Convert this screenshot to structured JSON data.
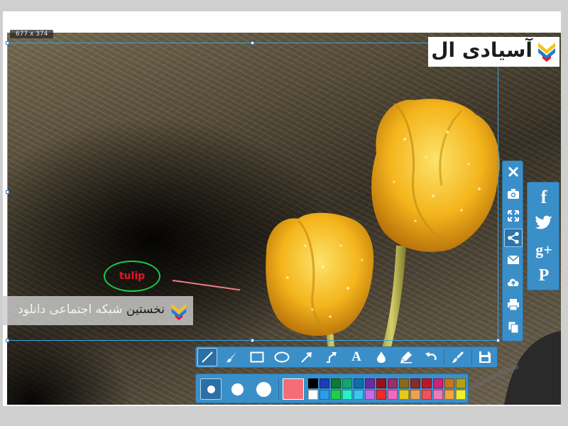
{
  "selection": {
    "size_label": "677 x 374"
  },
  "logo": {
    "text": "آسیادی ال",
    "accent": "#1a7fd0",
    "accent2": "#e8142a",
    "accent3": "#f7c21a"
  },
  "watermark": {
    "text_highlight": "نخستین",
    "text_rest": "شبکه اجتماعی دانلود"
  },
  "annotations": {
    "ellipse_text": "tulip",
    "ellipse_color": "#19c94a",
    "text_color": "#e8142a",
    "line_color": "#f07a86"
  },
  "side_tools": [
    {
      "name": "close-button",
      "icon": "close-icon"
    },
    {
      "name": "screenshot-button",
      "icon": "camera-icon"
    },
    {
      "name": "fullscreen-button",
      "icon": "expand-icon"
    },
    {
      "name": "share-button",
      "icon": "share-icon",
      "active": true
    },
    {
      "name": "email-button",
      "icon": "mail-icon"
    },
    {
      "name": "upload-button",
      "icon": "cloud-upload-icon"
    },
    {
      "name": "print-button",
      "icon": "print-icon"
    },
    {
      "name": "copy-button",
      "icon": "copy-icon"
    }
  ],
  "social": {
    "facebook": "f",
    "twitter": "twitter-bird-icon",
    "googleplus": "g+",
    "pinterest": "P"
  },
  "toolbar": {
    "text_tool": "A",
    "tools": [
      "line-icon",
      "brush-icon",
      "rectangle-icon",
      "ellipse-icon",
      "arrow-icon",
      "curved-arrow-icon",
      "text-icon",
      "blur-drop-icon",
      "marker-icon",
      "undo-icon",
      "eraser-icon",
      "save-icon"
    ]
  },
  "palette": {
    "current_color": "#f36d78",
    "brush_sizes": [
      "small",
      "medium",
      "large"
    ],
    "swatches": [
      "#000000",
      "#1a3eb5",
      "#0e7a2a",
      "#13a86a",
      "#0f6ea8",
      "#6a2aa0",
      "#9a0f18",
      "#9a2f6a",
      "#8a6a1a",
      "#8a2a2a",
      "#b8182a",
      "#d21f7a",
      "#c8760f",
      "#b8a010",
      "#ffffff",
      "#2a9ee8",
      "#1fcf4a",
      "#2af0c8",
      "#39c6f0",
      "#c86ae8",
      "#f02a2a",
      "#f06ac0",
      "#e8c81a",
      "#f0a050",
      "#f0525f",
      "#f07ab8",
      "#f7a23a",
      "#f0f02a"
    ]
  }
}
